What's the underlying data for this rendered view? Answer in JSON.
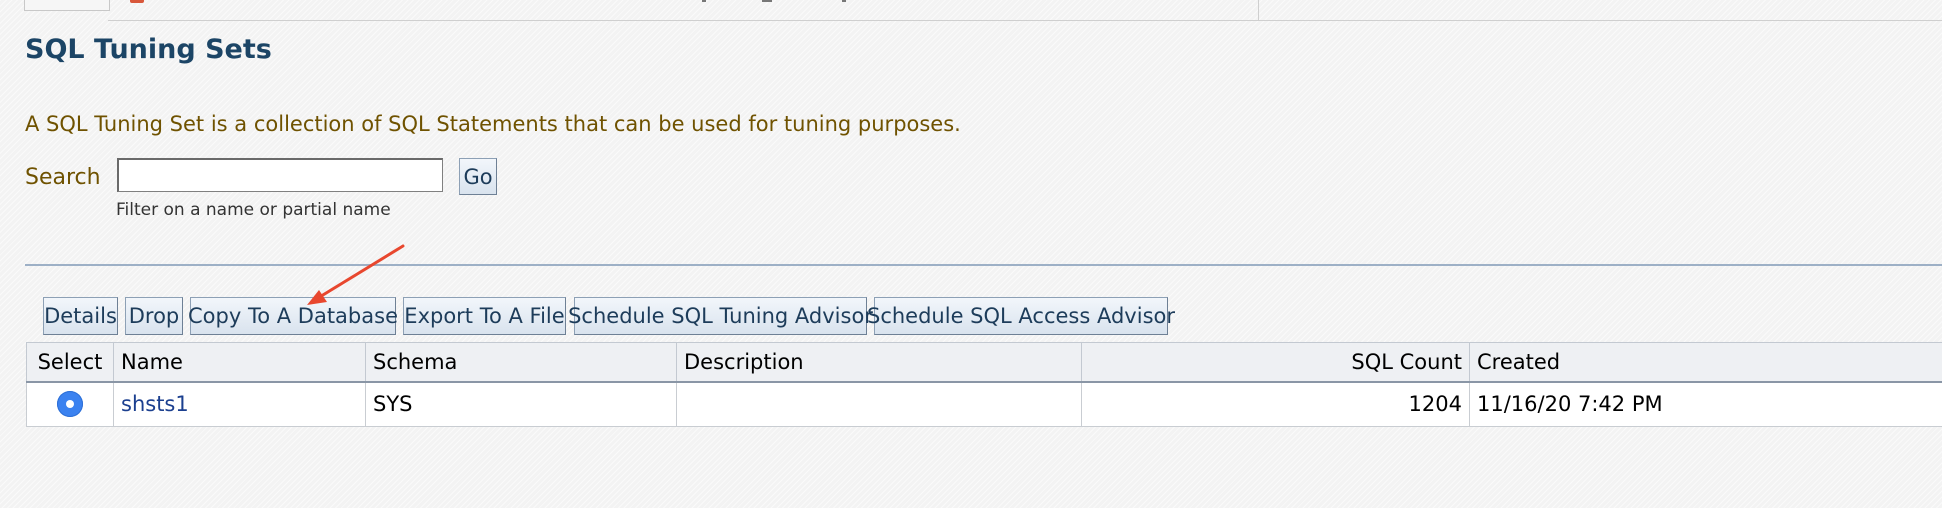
{
  "page": {
    "title": "SQL Tuning Sets",
    "intro": "A SQL Tuning Set is a collection of SQL Statements that can be used for tuning purposes."
  },
  "search": {
    "label": "Search",
    "value": "",
    "go_label": "Go",
    "hint": "Filter on a name or partial name"
  },
  "toolbar": {
    "details_label": "Details",
    "drop_label": "Drop",
    "copy_label": "Copy To A Database",
    "export_label": "Export To A File",
    "tuning_advisor_label": "Schedule SQL Tuning Advisor",
    "access_advisor_label": "Schedule SQL Access Advisor"
  },
  "table": {
    "headers": {
      "select": "Select",
      "name": "Name",
      "schema": "Schema",
      "description": "Description",
      "sql_count": "SQL Count",
      "created": "Created"
    },
    "rows": [
      {
        "selected": true,
        "name": "shsts1",
        "schema": "SYS",
        "description": "",
        "sql_count": "1204",
        "created": "11/16/20 7:42 PM"
      }
    ]
  },
  "annotation": {
    "arrow_color": "#e8472e"
  },
  "colors": {
    "title": "#1c4566",
    "instruction_text": "#6f5200",
    "link": "#1b3f8f",
    "radio_selected": "#3b82f0"
  }
}
